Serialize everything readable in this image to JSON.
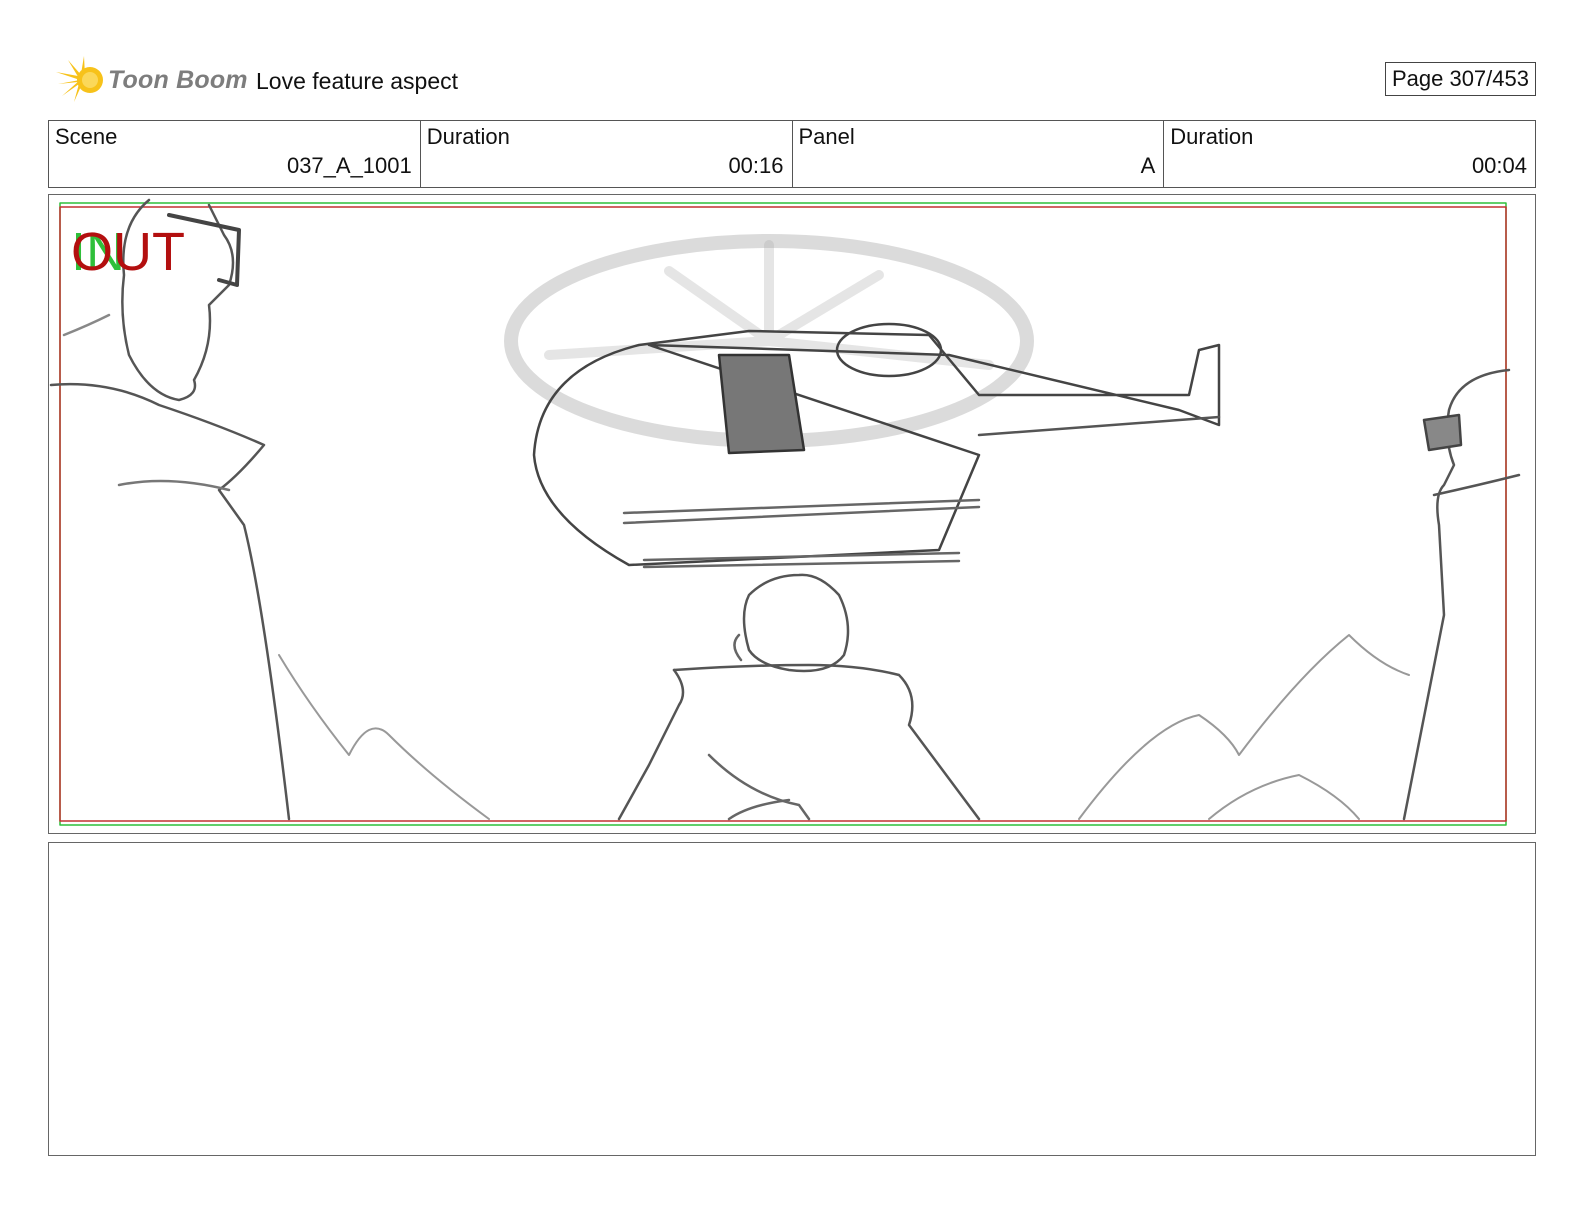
{
  "header": {
    "logo_text": "Toon Boom",
    "project_title": "Love feature aspect",
    "page_label": "Page 307/453"
  },
  "info": {
    "scene_label": "Scene",
    "scene_value": "037_A_1001",
    "scene_duration_label": "Duration",
    "scene_duration_value": "00:16",
    "panel_label": "Panel",
    "panel_value": "A",
    "panel_duration_label": "Duration",
    "panel_duration_value": "00:04"
  },
  "panel": {
    "in_marker": "IN",
    "out_marker": "OUT",
    "safe_frame_color": "#2fbf3a",
    "action_frame_color": "#c43030"
  },
  "notes": {
    "text": ""
  },
  "colors": {
    "logo_star": "#f7c21a",
    "logo_text": "#7d7d7d"
  }
}
